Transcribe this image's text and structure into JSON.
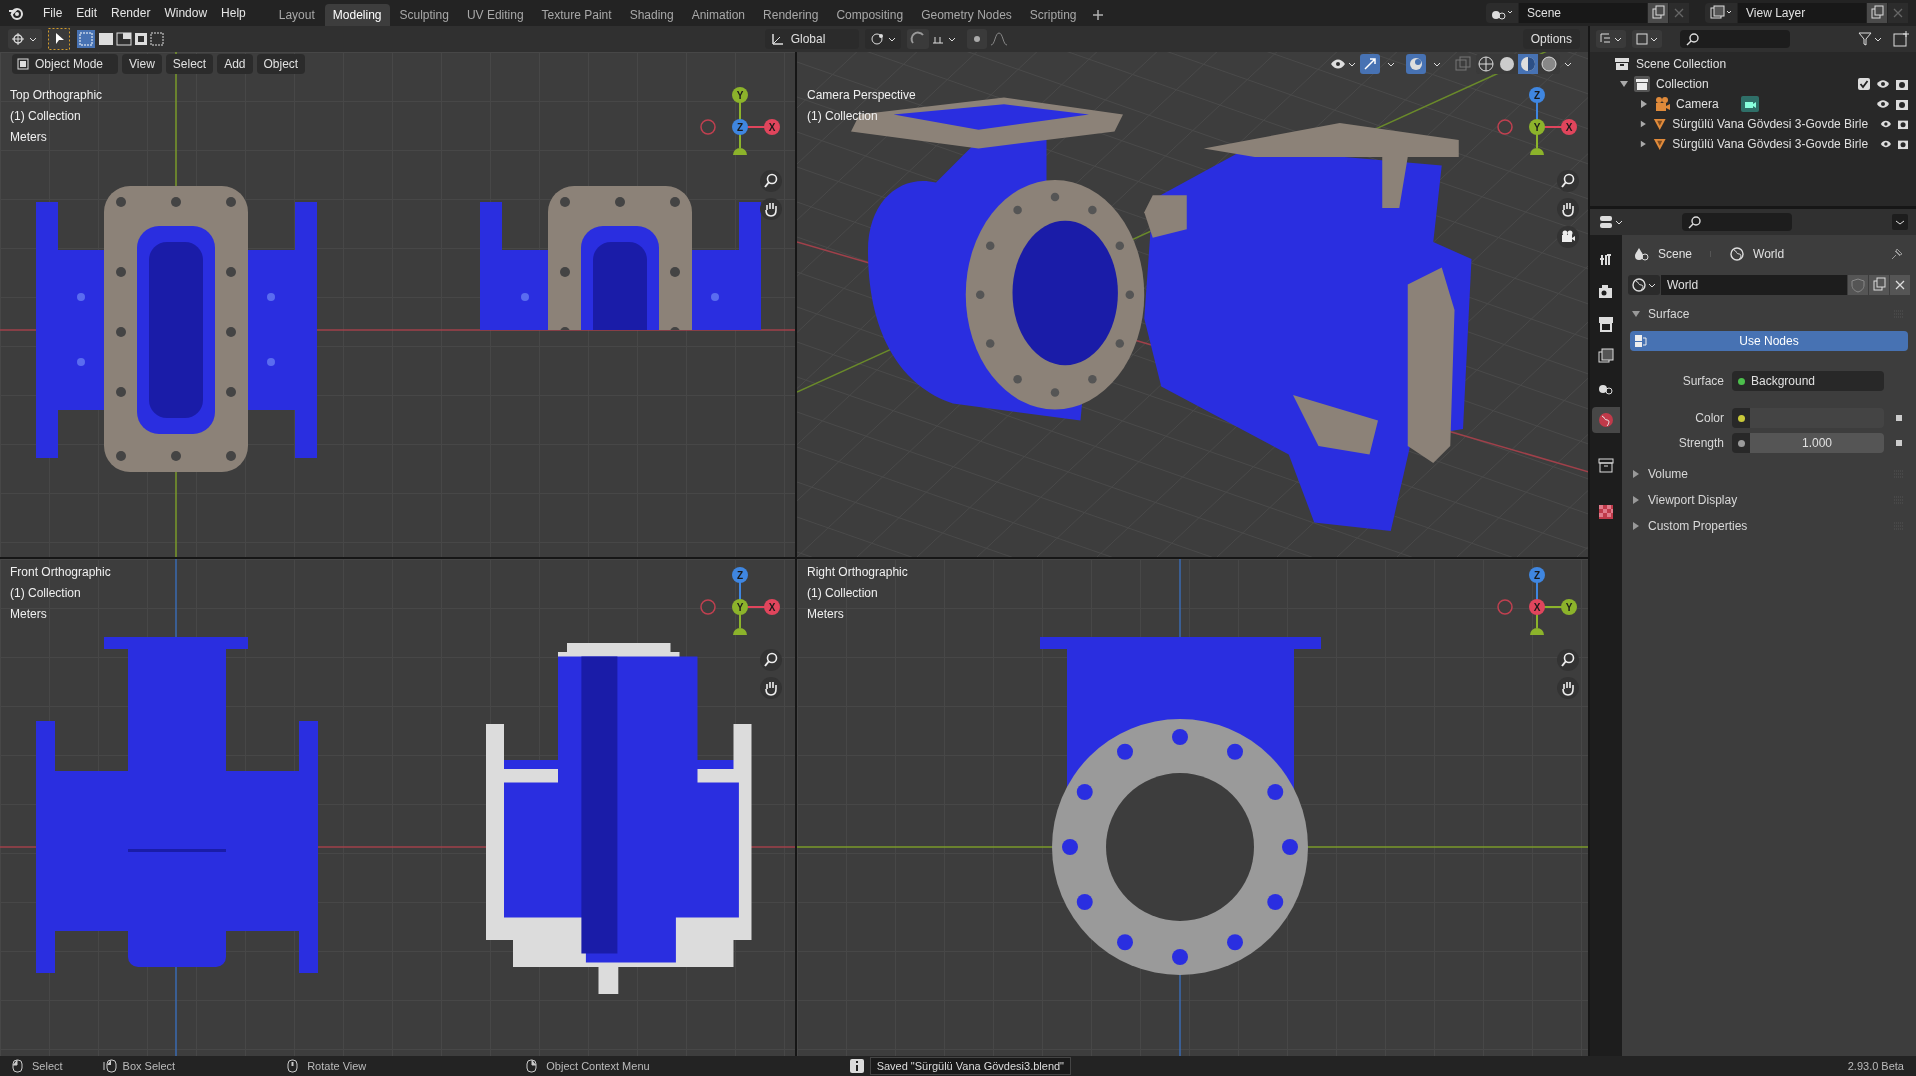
{
  "app_menu": [
    "File",
    "Edit",
    "Render",
    "Window",
    "Help"
  ],
  "workspaces": [
    {
      "label": "Layout",
      "selected": false
    },
    {
      "label": "Modeling",
      "selected": true
    },
    {
      "label": "Sculpting",
      "selected": false
    },
    {
      "label": "UV Editing",
      "selected": false
    },
    {
      "label": "Texture Paint",
      "selected": false
    },
    {
      "label": "Shading",
      "selected": false
    },
    {
      "label": "Animation",
      "selected": false
    },
    {
      "label": "Rendering",
      "selected": false
    },
    {
      "label": "Compositing",
      "selected": false
    },
    {
      "label": "Geometry Nodes",
      "selected": false
    },
    {
      "label": "Scripting",
      "selected": false
    }
  ],
  "scene_selector": {
    "value": "Scene"
  },
  "view_layer_selector": {
    "value": "View Layer"
  },
  "tool_header": {
    "orientation": "Global",
    "options": "Options"
  },
  "viewport_header": {
    "mode": "Object Mode",
    "menus": [
      "View",
      "Select",
      "Add",
      "Object"
    ]
  },
  "viewports": [
    {
      "kind": "top",
      "title": "Top Orthographic",
      "collection": "(1) Collection",
      "units": "Meters",
      "gizmo": [
        {
          "label": "Y",
          "color": "#8cb32b"
        },
        {
          "label": "Z",
          "color": "#3f86e0"
        },
        {
          "label": "X",
          "color": "#e0455c"
        }
      ]
    },
    {
      "kind": "camera",
      "title": "Camera Perspective",
      "collection": "(1) Collection",
      "gizmo": [
        {
          "label": "Z",
          "color": "#3f86e0"
        },
        {
          "label": "Y",
          "color": "#8cb32b"
        },
        {
          "label": "X",
          "color": "#e0455c"
        }
      ]
    },
    {
      "kind": "front",
      "title": "Front Orthographic",
      "collection": "(1) Collection",
      "units": "Meters",
      "gizmo": [
        {
          "label": "Z",
          "color": "#3f86e0"
        },
        {
          "label": "Y",
          "color": "#8cb32b"
        },
        {
          "label": "X",
          "color": "#e0455c"
        }
      ]
    },
    {
      "kind": "right",
      "title": "Right Orthographic",
      "collection": "(1) Collection",
      "units": "Meters",
      "gizmo": [
        {
          "label": "Z",
          "color": "#3f86e0"
        },
        {
          "label": "X",
          "color": "#e0455c"
        },
        {
          "label": "Y",
          "color": "#8cb32b"
        }
      ]
    }
  ],
  "outliner": {
    "items": [
      {
        "label": "Scene Collection",
        "kind": "scene",
        "children": [
          {
            "label": "Collection",
            "kind": "collection",
            "expanded": true,
            "checked": true,
            "children": [
              {
                "label": "Camera",
                "kind": "camera",
                "expanded": false
              },
              {
                "label": "Sürgülü Vana Gövdesi 3-Govde Birle",
                "kind": "mesh",
                "expanded": false
              },
              {
                "label": "Sürgülü Vana Gövdesi 3-Govde Birle",
                "kind": "mesh",
                "expanded": false
              }
            ]
          }
        ]
      }
    ]
  },
  "properties": {
    "tabs": [
      {
        "kind": "tool",
        "selected": false
      },
      {
        "kind": "render",
        "selected": false
      },
      {
        "kind": "output",
        "selected": false
      },
      {
        "kind": "view_layer",
        "selected": false
      },
      {
        "kind": "scene",
        "selected": false
      },
      {
        "kind": "world",
        "selected": true
      },
      {
        "kind": "collection",
        "selected": false
      },
      {
        "kind": "texture",
        "selected": false
      }
    ],
    "breadcrumb": [
      "Scene",
      "World"
    ],
    "world_field": "World",
    "panels": [
      {
        "label": "Surface",
        "expanded": true,
        "use_nodes": "Use Nodes",
        "fields": [
          {
            "label": "Surface",
            "kind": "node",
            "value": "Background",
            "color": "#4cbf4c"
          },
          {
            "label": "Color",
            "kind": "color",
            "color": "#c9c93a"
          },
          {
            "label": "Strength",
            "kind": "number",
            "value": "1.000",
            "color": "#9a9a9a"
          }
        ]
      },
      {
        "label": "Volume",
        "expanded": false
      },
      {
        "label": "Viewport Display",
        "expanded": false
      },
      {
        "label": "Custom Properties",
        "expanded": false
      }
    ]
  },
  "status_bar": {
    "hints": [
      {
        "kind": "left",
        "label": "Select"
      },
      {
        "kind": "drag",
        "label": "Box Select"
      },
      {
        "kind": "middle",
        "label": "Rotate View"
      },
      {
        "kind": "right",
        "label": "Object Context Menu"
      }
    ],
    "message": "Saved \"Sürgülü Vana Gövdesi3.blend\"",
    "version": "2.93.0 Beta"
  }
}
